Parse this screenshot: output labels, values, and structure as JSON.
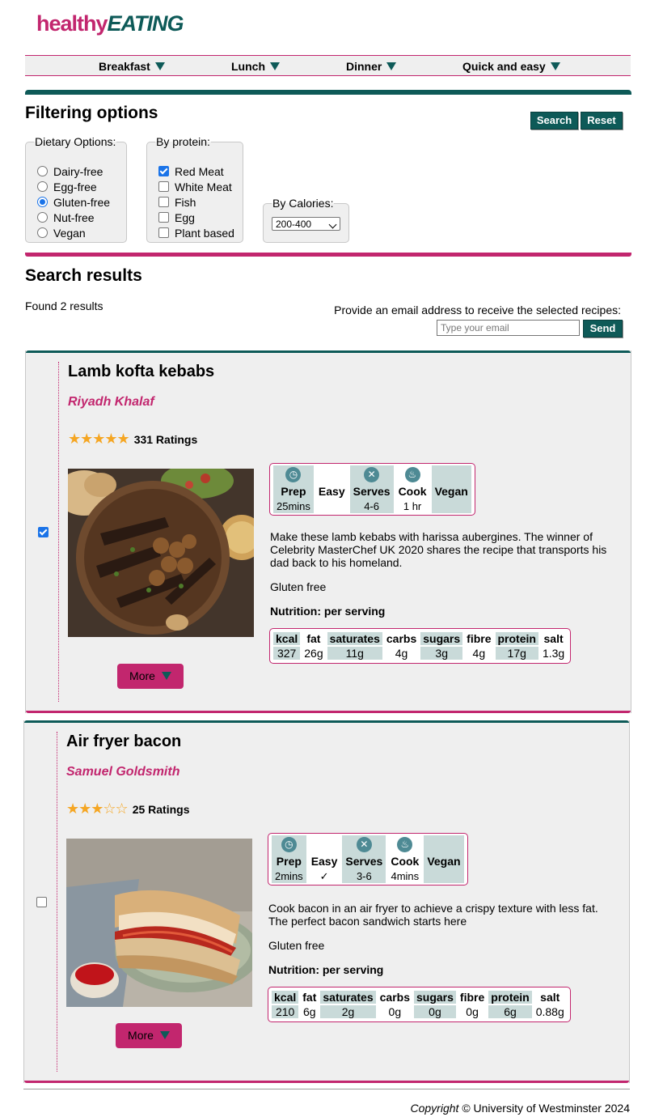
{
  "logo": {
    "part1": "healthy",
    "part2": "EATING"
  },
  "nav": [
    {
      "label": "Breakfast"
    },
    {
      "label": "Lunch"
    },
    {
      "label": "Dinner"
    },
    {
      "label": "Quick and easy"
    }
  ],
  "filter": {
    "title": "Filtering options",
    "search_label": "Search",
    "reset_label": "Reset",
    "dietary": {
      "legend": "Dietary Options:",
      "options": [
        {
          "label": "Dairy-free",
          "checked": false
        },
        {
          "label": "Egg-free",
          "checked": false
        },
        {
          "label": "Gluten-free",
          "checked": true
        },
        {
          "label": "Nut-free",
          "checked": false
        },
        {
          "label": "Vegan",
          "checked": false
        }
      ]
    },
    "protein": {
      "legend": "By protein:",
      "options": [
        {
          "label": "Red Meat",
          "checked": true
        },
        {
          "label": "White Meat",
          "checked": false
        },
        {
          "label": "Fish",
          "checked": false
        },
        {
          "label": "Egg",
          "checked": false
        },
        {
          "label": "Plant based",
          "checked": false
        }
      ]
    },
    "calories": {
      "legend": "By Calories:",
      "selected": "200-400"
    }
  },
  "results": {
    "title": "Search results",
    "count_text": "Found 2 results",
    "email_prompt": "Provide an email address to receive the selected recipes:",
    "email_placeholder": "Type your email",
    "send_label": "Send"
  },
  "recipes": [
    {
      "selected": true,
      "title": "Lamb kofta kebabs",
      "author": "Riyadh Khalaf",
      "stars": "★★★★★",
      "stars_empty": "",
      "rating": 5,
      "ratings_text": "331 Ratings",
      "info": {
        "headers": [
          "Prep",
          "Easy",
          "Serves",
          "Cook",
          "Vegan"
        ],
        "values": [
          "25mins",
          "",
          "4-6",
          "1 hr",
          ""
        ]
      },
      "description": "Make these lamb kebabs with harissa aubergines. The winner of Celebrity MasterChef UK 2020 shares the recipe that transports his dad back to his homeland.",
      "diet": "Gluten free",
      "nutrition_title": "Nutrition: per serving",
      "nutrition": {
        "headers": [
          "kcal",
          "fat",
          "saturates",
          "carbs",
          "sugars",
          "fibre",
          "protein",
          "salt"
        ],
        "values": [
          "327",
          "26g",
          "11g",
          "4g",
          "3g",
          "4g",
          "17g",
          "1.3g"
        ]
      },
      "more_label": "More"
    },
    {
      "selected": false,
      "title": "Air fryer bacon",
      "author": "Samuel Goldsmith",
      "stars": "★★★",
      "stars_empty": "☆☆",
      "rating": 3,
      "ratings_text": "25 Ratings",
      "info": {
        "headers": [
          "Prep",
          "Easy",
          "Serves",
          "Cook",
          "Vegan"
        ],
        "values": [
          "2mins",
          "✓",
          "3-6",
          "4mins",
          ""
        ]
      },
      "description": "Cook bacon in an air fryer to achieve a crispy texture with less fat. The perfect bacon sandwich starts here",
      "diet": "Gluten free",
      "nutrition_title": "Nutrition: per serving",
      "nutrition": {
        "headers": [
          "kcal",
          "fat",
          "saturates",
          "carbs",
          "sugars",
          "fibre",
          "protein",
          "salt"
        ],
        "values": [
          "210",
          "6g",
          "2g",
          "0g",
          "0g",
          "0g",
          "6g",
          "0.88g"
        ]
      },
      "more_label": "More"
    }
  ],
  "footer": {
    "copyright_word": "Copyright",
    "text": "© University of Westminster 2024"
  },
  "colors": {
    "brand_pink": "#c2266e",
    "brand_teal": "#0e5a58",
    "table_shade": "#c9dad9",
    "star": "#f5a623"
  }
}
